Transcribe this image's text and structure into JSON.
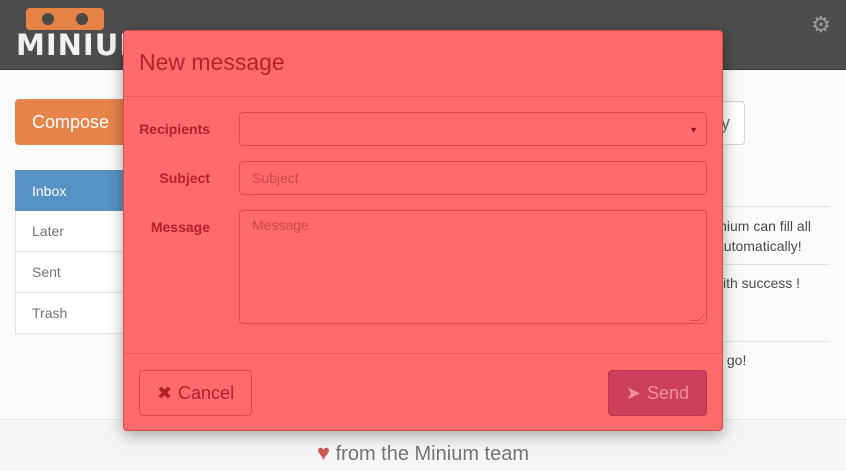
{
  "app": {
    "logo_text": "MINIUM",
    "settings_icon": "gear-icon"
  },
  "toolbar": {
    "compose_label": "Compose",
    "right_button_label": "y"
  },
  "sidebar": {
    "items": [
      {
        "label": "Inbox",
        "active": true
      },
      {
        "label": "Later"
      },
      {
        "label": "Sent"
      },
      {
        "label": "Trash"
      }
    ]
  },
  "messages": {
    "line1": "inium can fill all",
    "line2": "automatically!",
    "line3": "vith success !",
    "line4": "s go!"
  },
  "footer": {
    "text": "from the Minium team",
    "icon": "heart-icon"
  },
  "modal": {
    "title": "New message",
    "recipients_label": "Recipients",
    "recipients_value": "",
    "subject_label": "Subject",
    "subject_placeholder": "Subject",
    "message_label": "Message",
    "message_placeholder": "Message",
    "cancel_label": "Cancel",
    "cancel_icon": "close-icon",
    "send_label": "Send",
    "send_icon": "paper-plane-icon",
    "colors": {
      "modal_bg": "#ff6b6b",
      "send_bg": "#cc3f5c"
    }
  }
}
